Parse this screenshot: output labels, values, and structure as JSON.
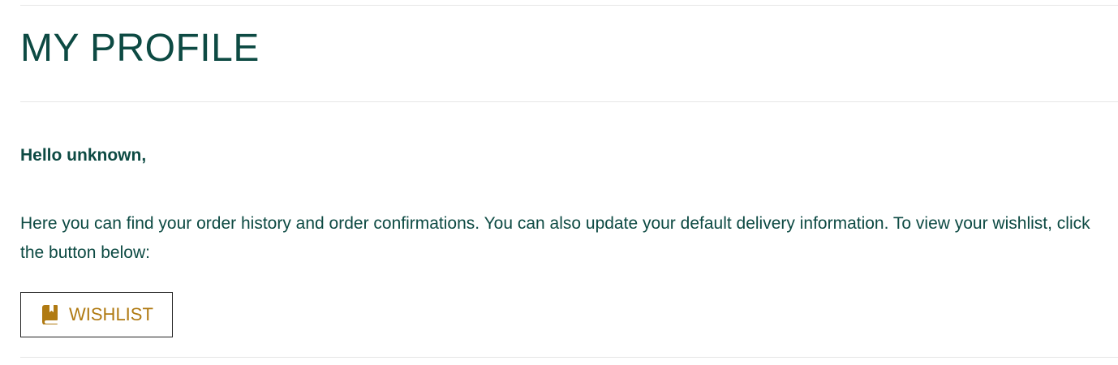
{
  "colors": {
    "heading": "#0d4a43",
    "body_text": "#0d4a43",
    "accent": "#b07a12",
    "divider": "#e6e6e6",
    "button_border": "#222222"
  },
  "header": {
    "title": "MY PROFILE"
  },
  "main": {
    "greeting": "Hello unknown,",
    "intro": "Here you can find your order history and order confirmations. You can also update your default delivery information. To view your wishlist, click the button below:",
    "wishlist_button": {
      "label": "WISHLIST",
      "icon": "book-bookmark-icon"
    }
  }
}
